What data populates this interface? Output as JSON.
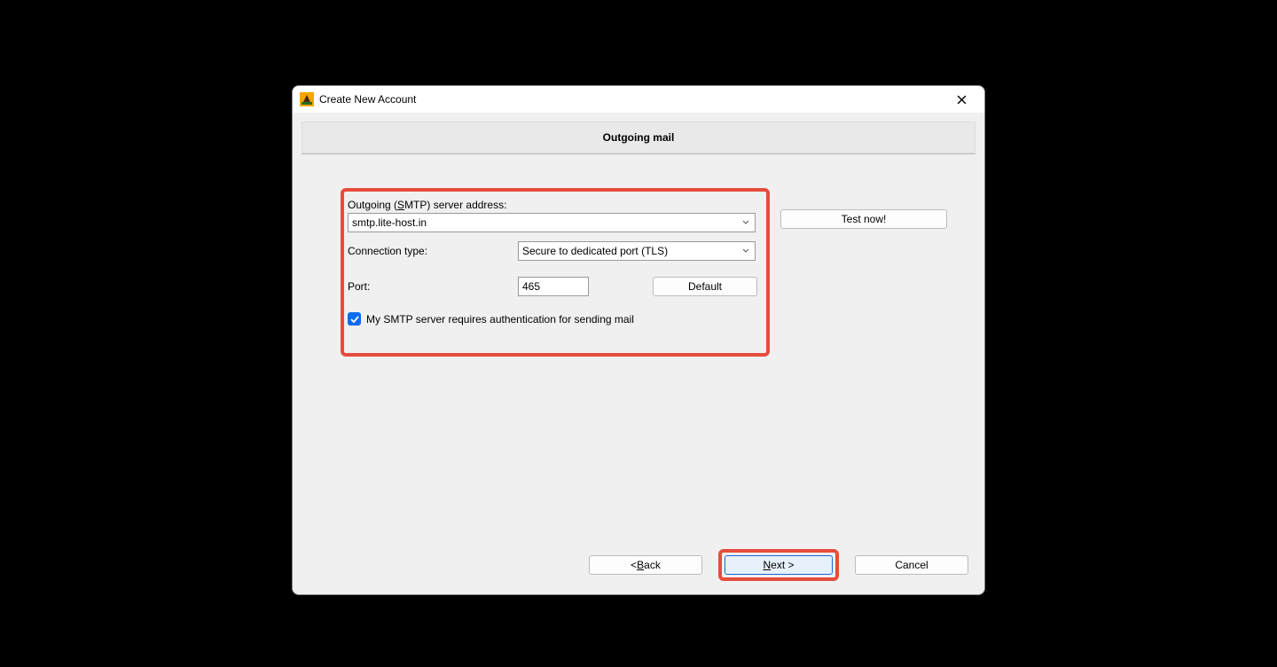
{
  "window": {
    "title": "Create New Account"
  },
  "section": {
    "header": "Outgoing mail"
  },
  "form": {
    "server_label_prefix": "Outgoing (",
    "server_label_u": "S",
    "server_label_suffix": "MTP) server address:",
    "server_value": "smtp.lite-host.in",
    "conn_label": "Connection type:",
    "conn_value": "Secure to dedicated port (TLS)",
    "port_label": "Port:",
    "port_value": "465",
    "default_btn": "Default",
    "auth_checkbox_label": "My SMTP server requires authentication for sending mail"
  },
  "actions": {
    "test_now": "Test now!"
  },
  "footer": {
    "back_prefix": "<  ",
    "back_u": "B",
    "back_suffix": "ack",
    "next_u": "N",
    "next_suffix": "ext   >",
    "cancel": "Cancel"
  }
}
